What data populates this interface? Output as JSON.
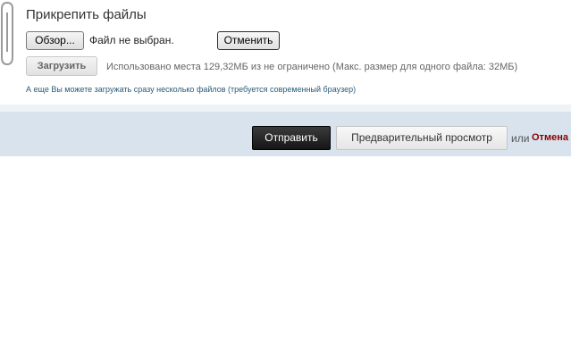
{
  "attach": {
    "title": "Прикрепить файлы",
    "browse_label": "Обзор...",
    "no_file_text": "Файл не выбран.",
    "cancel_label": "Отменить",
    "upload_label": "Загрузить",
    "usage_text": "Использовано места 129,32МБ из не ограничено (Макс. размер для одного файла: 32МБ)",
    "multi_upload_link": "А еще Вы можете загружать сразу несколько файлов (требуется современный браузер)"
  },
  "actions": {
    "submit_label": "Отправить",
    "preview_label": "Предварительный просмотр",
    "or_text": "или",
    "cancel_link": "Отмена"
  },
  "icons": {
    "attach": "paperclip-icon"
  },
  "colors": {
    "cancel_link": "#8b0000",
    "bar_background": "#d9e3ed",
    "submit_background": "#222222"
  }
}
